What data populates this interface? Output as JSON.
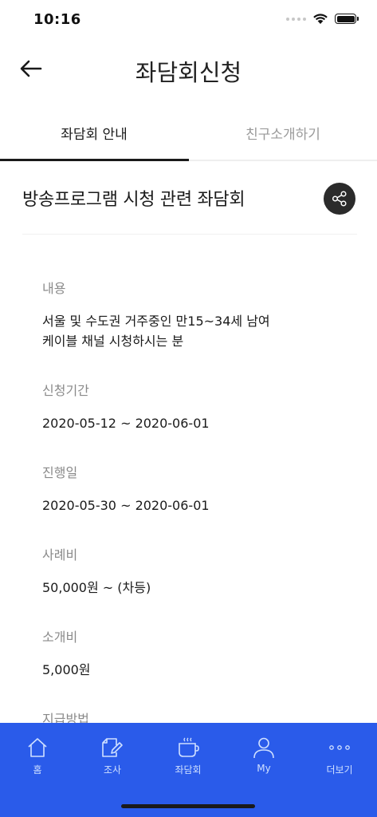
{
  "status_bar": {
    "time": "10:16"
  },
  "header": {
    "title": "좌담회신청"
  },
  "tabs": [
    {
      "label": "좌담회 안내",
      "active": true
    },
    {
      "label": "친구소개하기",
      "active": false
    }
  ],
  "event": {
    "title": "방송프로그램 시청 관련 좌담회"
  },
  "details": [
    {
      "label": "내용",
      "lines": [
        "서울 및 수도권 거주중인 만15~34세 남여",
        "케이블 채널 시청하시는 분"
      ]
    },
    {
      "label": "신청기간",
      "lines": [
        "2020-05-12 ~ 2020-06-01"
      ]
    },
    {
      "label": "진행일",
      "lines": [
        "2020-05-30 ~ 2020-06-01"
      ]
    },
    {
      "label": "사례비",
      "lines": [
        "50,000원 ~ (차등)"
      ]
    },
    {
      "label": "소개비",
      "lines": [
        "5,000원"
      ]
    },
    {
      "label": "지급방법",
      "lines": []
    }
  ],
  "bottom_nav": [
    {
      "label": "홈",
      "icon": "home-icon"
    },
    {
      "label": "조사",
      "icon": "survey-icon"
    },
    {
      "label": "좌담회",
      "icon": "coffee-cup-icon"
    },
    {
      "label": "My",
      "icon": "person-icon"
    },
    {
      "label": "더보기",
      "icon": "more-dots-icon"
    }
  ],
  "colors": {
    "nav_background": "#2a5bea",
    "nav_foreground": "#cfe0ff",
    "share_button": "#2b2b2b"
  }
}
